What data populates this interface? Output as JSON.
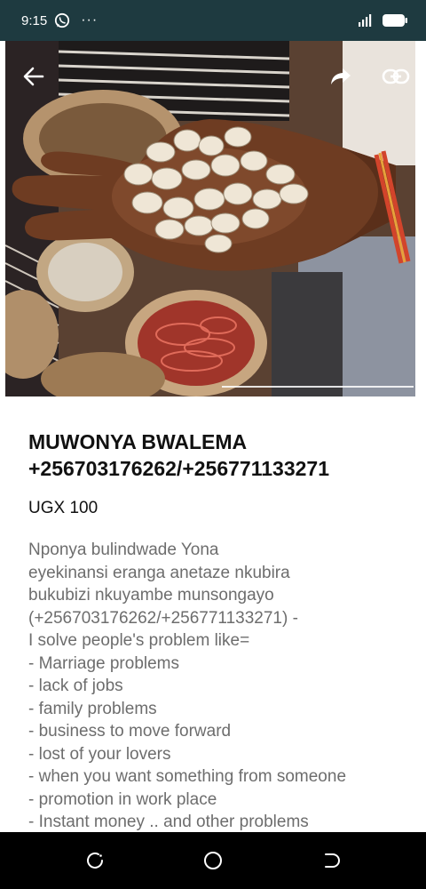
{
  "status_bar": {
    "time": "9:15",
    "more": "···",
    "icons": [
      "whatsapp-icon",
      "signal-icon",
      "battery-icon"
    ]
  },
  "hero": {
    "image": "hand holding cowrie shells over baskets of beads",
    "icons": [
      "back-arrow-icon",
      "share-arrow-icon",
      "link-icon"
    ]
  },
  "listing": {
    "title_line1": "MUWONYA BWALEMA",
    "title_line2": "+256703176262/+256771133271",
    "price": "UGX 100",
    "description": [
      "Nponya bulindwade Yona",
      "eyekinansi eranga anetaze nkubira",
      "bukubizi nkuyambe munsongayo",
      "(+256703176262/+256771133271) -",
      "I solve people's problem like=",
      "- Marriage problems",
      "- lack of jobs",
      "- family problems",
      "- business to move forward",
      "- lost of your lovers",
      "- when you want something from someone",
      "- promotion in work place",
      "- Instant money .. and other problems"
    ]
  },
  "nav_bar": {
    "icons": [
      "recent-apps-icon",
      "home-icon",
      "back-icon"
    ]
  },
  "colors": {
    "status_bar": "#1e3a40",
    "title": "#111111",
    "description": "#6d6d6d",
    "nav_bar": "#000000"
  }
}
